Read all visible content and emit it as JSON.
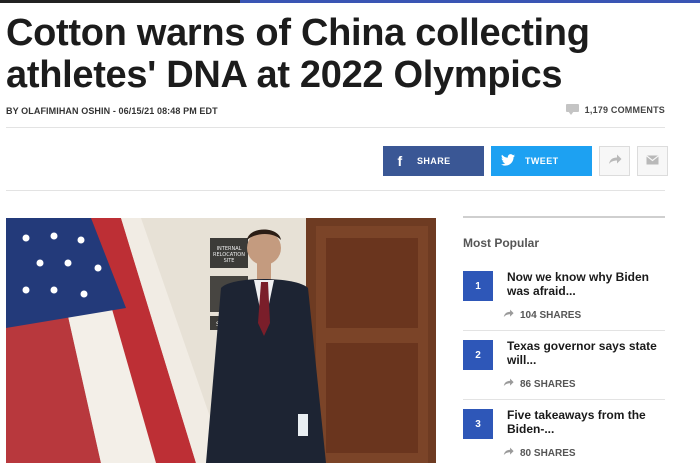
{
  "article": {
    "headline_line1": "Cotton warns of China collecting",
    "headline_line2": "athletes' DNA at 2022 Olympics",
    "byline": "BY OLAFIMIHAN OSHIN - 06/15/21 08:48 PM EDT",
    "comments": "1,179 COMMENTS",
    "photo_sign_1": "INTERNAL RELOCATION SITE",
    "photo_sign_2": "SB"
  },
  "share": {
    "facebook_label": "SHARE",
    "twitter_label": "TWEET",
    "facebook_icon": "f",
    "twitter_icon": "twitter-bird"
  },
  "sidebar": {
    "title": "Most Popular",
    "items": [
      {
        "number": "1",
        "title": "Now we know why Biden was afraid...",
        "shares": "104 SHARES"
      },
      {
        "number": "2",
        "title": "Texas governor says state will...",
        "shares": "86 SHARES"
      },
      {
        "number": "3",
        "title": "Five takeaways from the Biden-...",
        "shares": "80 SHARES"
      }
    ]
  },
  "colors": {
    "facebook": "#3a5795",
    "twitter": "#1da1f2",
    "popular_badge": "#2e57b8"
  }
}
